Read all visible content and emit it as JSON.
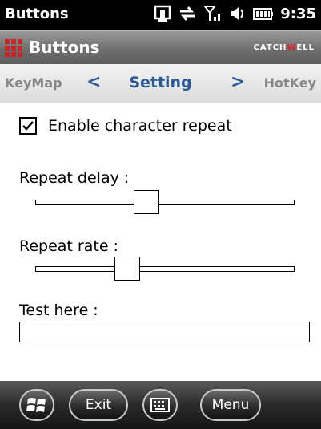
{
  "status": {
    "title": "Buttons",
    "time": "9:35"
  },
  "appbar": {
    "title": "Buttons",
    "brand_pre": "CATCH",
    "brand_mid": "W",
    "brand_post": "ELL"
  },
  "tabs": {
    "left": "KeyMap",
    "current": "Setting",
    "right": "HotKey",
    "prev_arrow": "<",
    "next_arrow": ">"
  },
  "settings": {
    "enable_repeat_label": "Enable character repeat",
    "enable_repeat_checked": true,
    "repeat_delay_label": "Repeat delay :",
    "repeat_delay_value": 0.42,
    "repeat_rate_label": "Repeat rate :",
    "repeat_rate_value": 0.34,
    "test_label": "Test here :",
    "test_value": ""
  },
  "bottombar": {
    "exit_label": "Exit",
    "menu_label": "Menu"
  },
  "colors": {
    "accent": "#2c5c97",
    "brand_red": "#e02020"
  }
}
